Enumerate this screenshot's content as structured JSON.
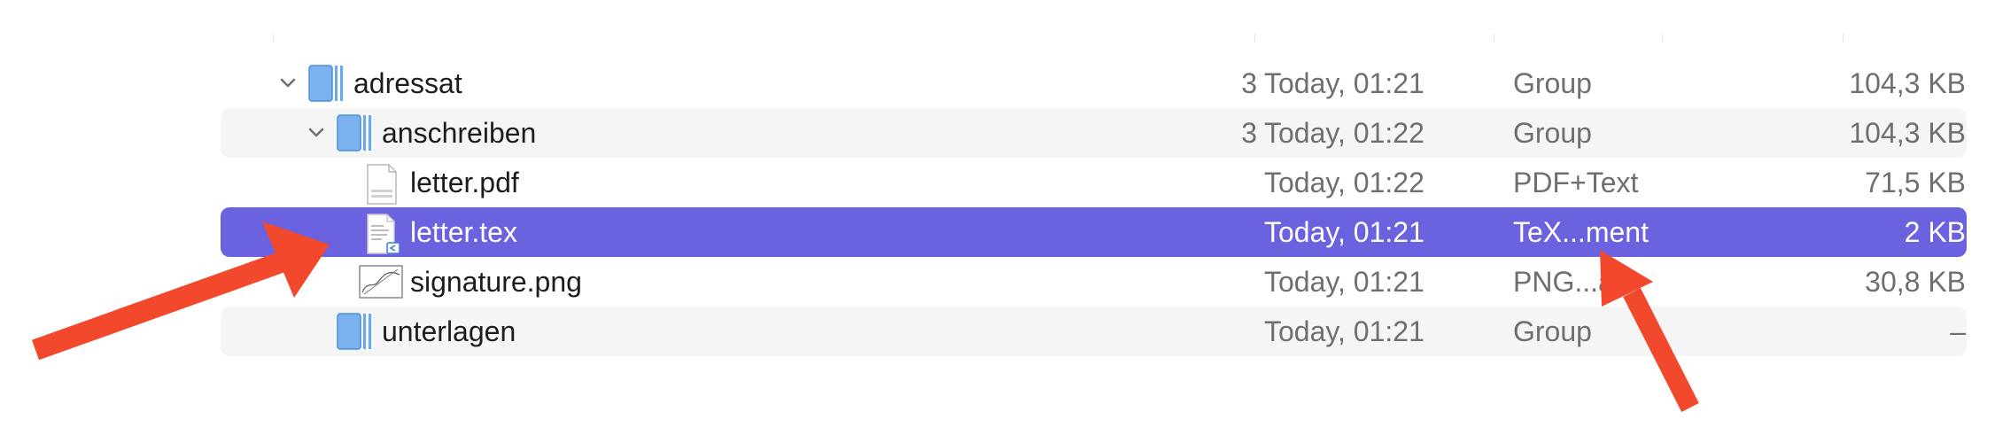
{
  "rows": [
    {
      "name": "adressat",
      "count": "3",
      "date": "Today, 01:21",
      "kind": "Group",
      "size": "104,3 KB",
      "icon": "folder-group-icon",
      "expanded": true
    },
    {
      "name": "anschreiben",
      "count": "3",
      "date": "Today, 01:22",
      "kind": "Group",
      "size": "104,3 KB",
      "icon": "folder-group-icon",
      "expanded": true
    },
    {
      "name": "letter.pdf",
      "count": "",
      "date": "Today, 01:22",
      "kind": "PDF+Text",
      "size": "71,5 KB",
      "icon": "pdf-document-icon"
    },
    {
      "name": "letter.tex",
      "count": "",
      "date": "Today, 01:21",
      "kind": "TeX...ment",
      "size": "2 KB",
      "icon": "tex-document-icon",
      "selected": true
    },
    {
      "name": "signature.png",
      "count": "",
      "date": "Today, 01:21",
      "kind": "PNG...a",
      "size": "30,8 KB",
      "icon": "png-image-icon"
    },
    {
      "name": "unterlagen",
      "count": "",
      "date": "Today, 01:21",
      "kind": "Group",
      "size": "–",
      "icon": "folder-group-icon"
    }
  ],
  "colors": {
    "selection": "#6b62e0",
    "arrow": "#f2482b",
    "folder": "#6aa8ec"
  }
}
